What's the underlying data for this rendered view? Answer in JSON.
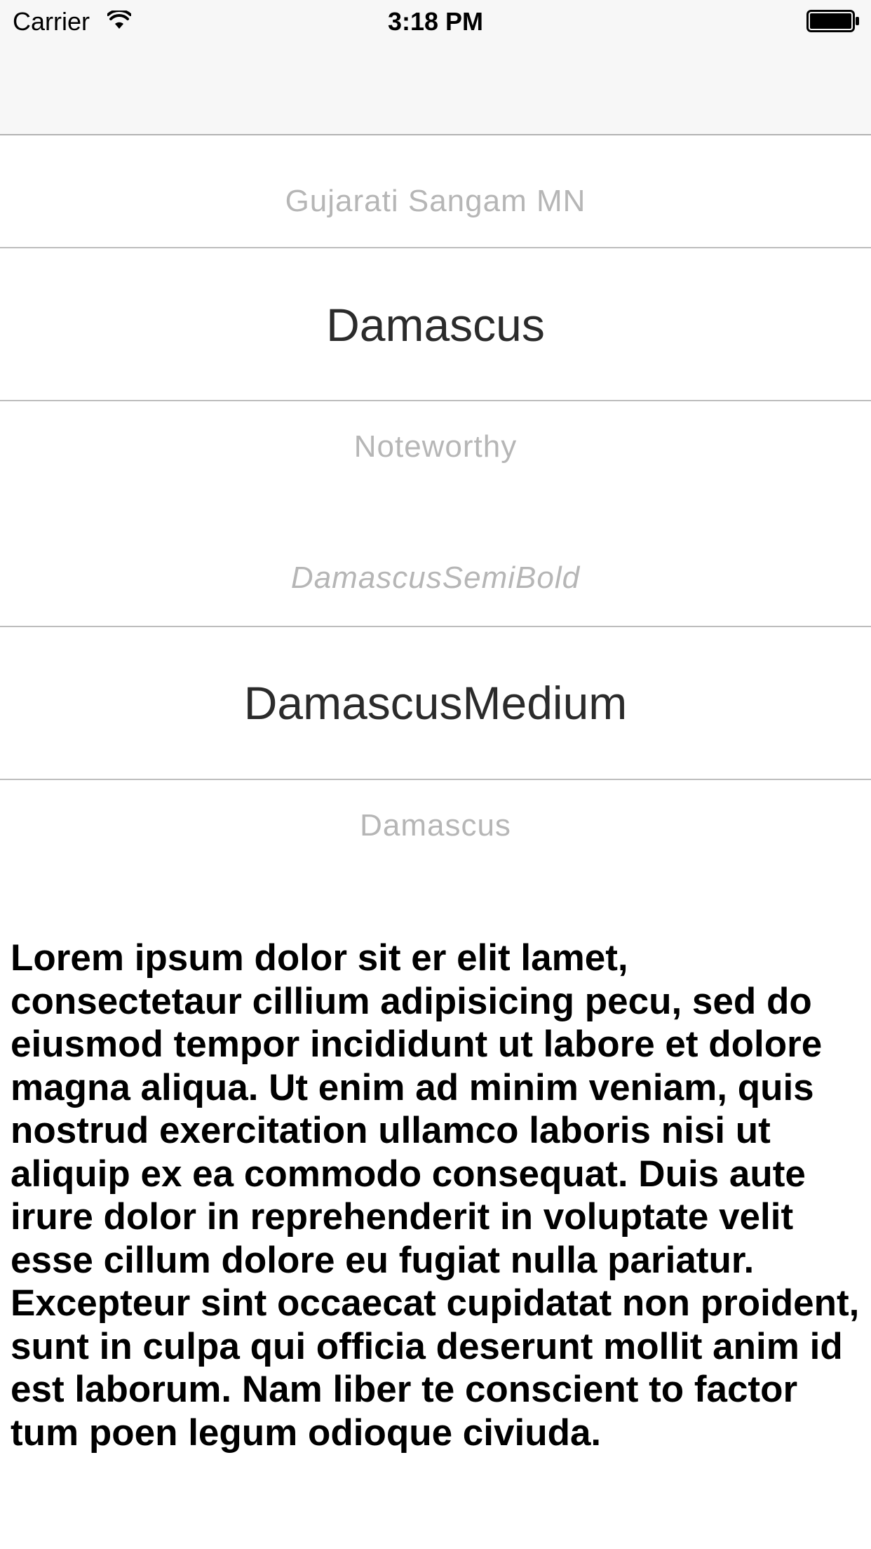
{
  "status_bar": {
    "carrier": "Carrier",
    "time": "3:18 PM",
    "wifi_icon": "wifi-icon",
    "battery_icon": "battery-icon"
  },
  "picker": {
    "rows": [
      {
        "label": "Gujarati Sangam MN",
        "selected": false
      },
      {
        "label": "Damascus",
        "selected": true
      },
      {
        "label": "Noteworthy",
        "selected": false
      },
      {
        "label": "DamascusSemiBold",
        "selected": false
      },
      {
        "label": "DamascusMedium",
        "selected": true
      },
      {
        "label": "Damascus",
        "selected": false
      }
    ]
  },
  "body": {
    "text": "Lorem ipsum dolor sit er elit lamet, consectetaur cillium adipisicing pecu, sed do eiusmod tempor incididunt ut labore et dolore magna aliqua. Ut enim ad minim veniam, quis nostrud exercitation ullamco laboris nisi ut aliquip ex ea commodo consequat. Duis aute irure dolor in reprehenderit in voluptate velit esse cillum dolore eu fugiat nulla pariatur. Excepteur sint occaecat cupidatat non proident, sunt in culpa qui officia deserunt mollit anim id est laborum. Nam liber te conscient to factor tum poen legum odioque civiuda."
  },
  "colors": {
    "bar_background": "#f7f7f7",
    "divider": "#bdbdbd",
    "faded_text": "#b6b6b6",
    "selected_text": "#2b2b2b"
  }
}
